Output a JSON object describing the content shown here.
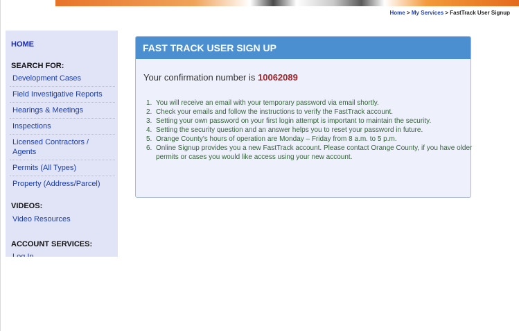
{
  "breadcrumb": {
    "home": "Home",
    "sep1": ">",
    "services": "My Services",
    "sep2": ">",
    "current": "FastTrack User Signup"
  },
  "sidebar": {
    "home": "HOME",
    "search_heading": "SEARCH FOR:",
    "search_items": [
      "Development Cases",
      "Field Investigative Reports",
      "Hearings & Meetings",
      "Inspections",
      "Licensed Contractors / Agents",
      "Permits (All Types)",
      "Property (Address/Parcel)"
    ],
    "videos_heading": "VIDEOS:",
    "video_items": [
      "Video Resources"
    ],
    "account_heading": "ACCOUNT SERVICES:",
    "account_items": [
      "Log In"
    ]
  },
  "panel": {
    "title": "FAST TRACK USER SIGN UP",
    "confirm_text": "Your confirmation number is",
    "confirm_number": "10062089",
    "steps": [
      "You will receive an email with your temporary password via email shortly.",
      "Check your emails and follow the instructions to verify the FastTrack account.",
      "Setting your own password on your first login attempt is important to maintain the security.",
      "Setting the security question and an answer helps you to reset your password in future.",
      "Orange County's hours of operation are Monday – Friday from 8 a.m. to 5 p.m.",
      "Online Signup provides you a new FastTrack account. Please contact Orange County, if you have older permits or cases you would like access using your new account."
    ]
  },
  "colors": {
    "panel_header": "#4b8fd0",
    "sidebar_bg": "#e1e4f6",
    "link": "#1a3cb0",
    "confirm_number": "#a3252b",
    "steps_text": "#35633a"
  }
}
